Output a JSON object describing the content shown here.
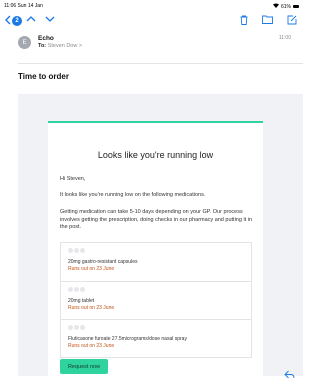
{
  "status": {
    "time": "11:06",
    "date": "Sun 14 Jan",
    "battery": "61%"
  },
  "toolbar": {
    "badge_count": "2",
    "icons": [
      "back-chevron-icon",
      "up-chevron-icon",
      "down-chevron-icon",
      "trash-icon",
      "folder-icon",
      "compose-icon"
    ]
  },
  "message": {
    "avatar_initial": "E",
    "sender": "Echo",
    "to_label": "To:",
    "recipient": "Steven Dow >",
    "time": "11:00",
    "subject": "Time to order"
  },
  "email": {
    "accent_color": "#2fd39d",
    "headline": "Looks like you're running low",
    "greeting": "Hi Steven,",
    "intro": "It looks like you're running low on the following medications.",
    "body": "Getting medication can take 5-10 days depending on your GP. Our process involves getting the prescription, doing checks in our pharmacy and putting it in the post.",
    "medications": [
      {
        "name": "20mg gastro-resistant capsules",
        "runs_out": "Runs out on 23 June"
      },
      {
        "name": "20mg tablet",
        "runs_out": "Runs out on 23 June"
      },
      {
        "name": "Fluticasone furoate 27.5micrograms/dose nasal spray",
        "runs_out": "Runs out on 23 June"
      }
    ],
    "button_label": "Request now"
  }
}
